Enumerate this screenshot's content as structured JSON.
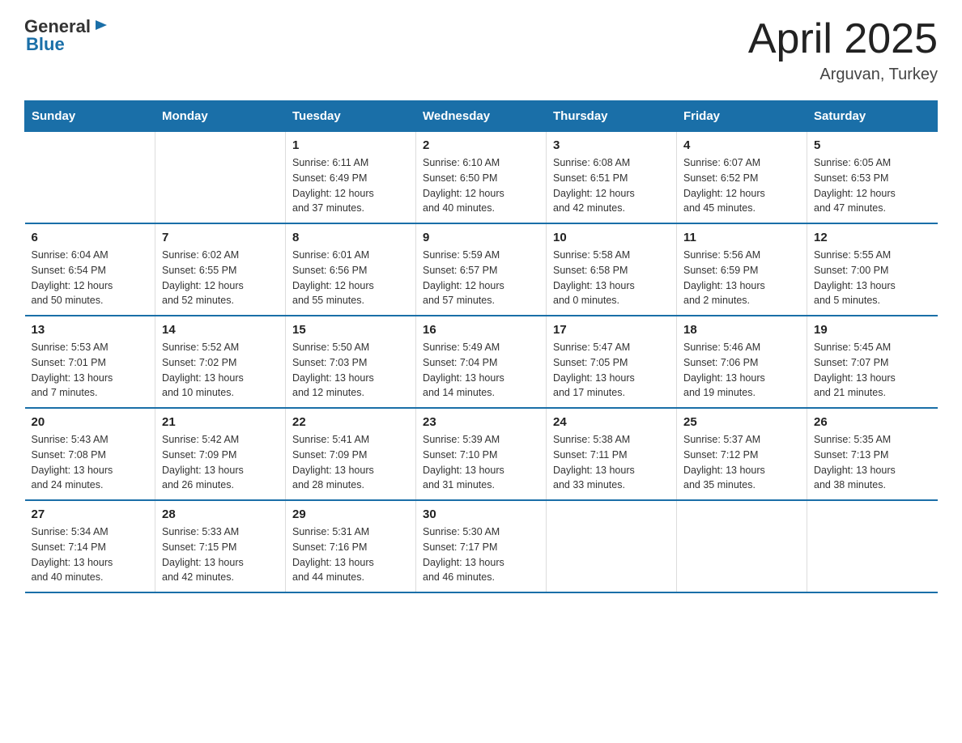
{
  "header": {
    "logo_general": "General",
    "logo_blue": "Blue",
    "month_year": "April 2025",
    "location": "Arguvan, Turkey"
  },
  "days_of_week": [
    "Sunday",
    "Monday",
    "Tuesday",
    "Wednesday",
    "Thursday",
    "Friday",
    "Saturday"
  ],
  "weeks": [
    [
      {
        "day": "",
        "info": ""
      },
      {
        "day": "",
        "info": ""
      },
      {
        "day": "1",
        "info": "Sunrise: 6:11 AM\nSunset: 6:49 PM\nDaylight: 12 hours\nand 37 minutes."
      },
      {
        "day": "2",
        "info": "Sunrise: 6:10 AM\nSunset: 6:50 PM\nDaylight: 12 hours\nand 40 minutes."
      },
      {
        "day": "3",
        "info": "Sunrise: 6:08 AM\nSunset: 6:51 PM\nDaylight: 12 hours\nand 42 minutes."
      },
      {
        "day": "4",
        "info": "Sunrise: 6:07 AM\nSunset: 6:52 PM\nDaylight: 12 hours\nand 45 minutes."
      },
      {
        "day": "5",
        "info": "Sunrise: 6:05 AM\nSunset: 6:53 PM\nDaylight: 12 hours\nand 47 minutes."
      }
    ],
    [
      {
        "day": "6",
        "info": "Sunrise: 6:04 AM\nSunset: 6:54 PM\nDaylight: 12 hours\nand 50 minutes."
      },
      {
        "day": "7",
        "info": "Sunrise: 6:02 AM\nSunset: 6:55 PM\nDaylight: 12 hours\nand 52 minutes."
      },
      {
        "day": "8",
        "info": "Sunrise: 6:01 AM\nSunset: 6:56 PM\nDaylight: 12 hours\nand 55 minutes."
      },
      {
        "day": "9",
        "info": "Sunrise: 5:59 AM\nSunset: 6:57 PM\nDaylight: 12 hours\nand 57 minutes."
      },
      {
        "day": "10",
        "info": "Sunrise: 5:58 AM\nSunset: 6:58 PM\nDaylight: 13 hours\nand 0 minutes."
      },
      {
        "day": "11",
        "info": "Sunrise: 5:56 AM\nSunset: 6:59 PM\nDaylight: 13 hours\nand 2 minutes."
      },
      {
        "day": "12",
        "info": "Sunrise: 5:55 AM\nSunset: 7:00 PM\nDaylight: 13 hours\nand 5 minutes."
      }
    ],
    [
      {
        "day": "13",
        "info": "Sunrise: 5:53 AM\nSunset: 7:01 PM\nDaylight: 13 hours\nand 7 minutes."
      },
      {
        "day": "14",
        "info": "Sunrise: 5:52 AM\nSunset: 7:02 PM\nDaylight: 13 hours\nand 10 minutes."
      },
      {
        "day": "15",
        "info": "Sunrise: 5:50 AM\nSunset: 7:03 PM\nDaylight: 13 hours\nand 12 minutes."
      },
      {
        "day": "16",
        "info": "Sunrise: 5:49 AM\nSunset: 7:04 PM\nDaylight: 13 hours\nand 14 minutes."
      },
      {
        "day": "17",
        "info": "Sunrise: 5:47 AM\nSunset: 7:05 PM\nDaylight: 13 hours\nand 17 minutes."
      },
      {
        "day": "18",
        "info": "Sunrise: 5:46 AM\nSunset: 7:06 PM\nDaylight: 13 hours\nand 19 minutes."
      },
      {
        "day": "19",
        "info": "Sunrise: 5:45 AM\nSunset: 7:07 PM\nDaylight: 13 hours\nand 21 minutes."
      }
    ],
    [
      {
        "day": "20",
        "info": "Sunrise: 5:43 AM\nSunset: 7:08 PM\nDaylight: 13 hours\nand 24 minutes."
      },
      {
        "day": "21",
        "info": "Sunrise: 5:42 AM\nSunset: 7:09 PM\nDaylight: 13 hours\nand 26 minutes."
      },
      {
        "day": "22",
        "info": "Sunrise: 5:41 AM\nSunset: 7:09 PM\nDaylight: 13 hours\nand 28 minutes."
      },
      {
        "day": "23",
        "info": "Sunrise: 5:39 AM\nSunset: 7:10 PM\nDaylight: 13 hours\nand 31 minutes."
      },
      {
        "day": "24",
        "info": "Sunrise: 5:38 AM\nSunset: 7:11 PM\nDaylight: 13 hours\nand 33 minutes."
      },
      {
        "day": "25",
        "info": "Sunrise: 5:37 AM\nSunset: 7:12 PM\nDaylight: 13 hours\nand 35 minutes."
      },
      {
        "day": "26",
        "info": "Sunrise: 5:35 AM\nSunset: 7:13 PM\nDaylight: 13 hours\nand 38 minutes."
      }
    ],
    [
      {
        "day": "27",
        "info": "Sunrise: 5:34 AM\nSunset: 7:14 PM\nDaylight: 13 hours\nand 40 minutes."
      },
      {
        "day": "28",
        "info": "Sunrise: 5:33 AM\nSunset: 7:15 PM\nDaylight: 13 hours\nand 42 minutes."
      },
      {
        "day": "29",
        "info": "Sunrise: 5:31 AM\nSunset: 7:16 PM\nDaylight: 13 hours\nand 44 minutes."
      },
      {
        "day": "30",
        "info": "Sunrise: 5:30 AM\nSunset: 7:17 PM\nDaylight: 13 hours\nand 46 minutes."
      },
      {
        "day": "",
        "info": ""
      },
      {
        "day": "",
        "info": ""
      },
      {
        "day": "",
        "info": ""
      }
    ]
  ],
  "colors": {
    "header_bg": "#1a6fa8",
    "header_text": "#ffffff",
    "border": "#1a6fa8",
    "text_dark": "#222222",
    "logo_blue": "#1a6fa8"
  }
}
